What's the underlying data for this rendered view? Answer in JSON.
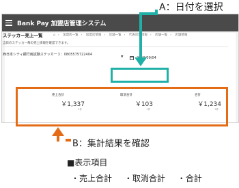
{
  "annotations": {
    "a_label": "A：日付を選択",
    "b_label": "B：集計結果を確認",
    "heading": "■表示項目",
    "items": [
      "・売上合計",
      "・取消合計",
      "・合計"
    ],
    "teal": "#1fb0a8",
    "orange": "#e56c17"
  },
  "app": {
    "title": "Bank Pay 加盟店管理システム",
    "menu_icon": "hamburger-menu-icon"
  },
  "page": {
    "title": "ステッカー売上一覧",
    "breadcrumbs": [
      "⌂",
      "加盟店一覧",
      "加盟店情報",
      "店舗一覧",
      "代表店舗情報",
      "店舗一覧",
      "店舗情報"
    ],
    "note": "当日のステッカー毎の売上情報を確認できます。",
    "sticker_selector": "西日本シティ銀行用試験ステッカー３：0805575722404",
    "selector_arrow": "▼",
    "date": "2019/09/04"
  },
  "totals": [
    {
      "caption": "売上合計",
      "value": "￥1,337",
      "unit": "2件"
    },
    {
      "caption": "取消合計",
      "value": "￥103",
      "unit": "1件"
    },
    {
      "caption": "合計",
      "value": "￥1,234",
      "unit": "3件"
    }
  ]
}
